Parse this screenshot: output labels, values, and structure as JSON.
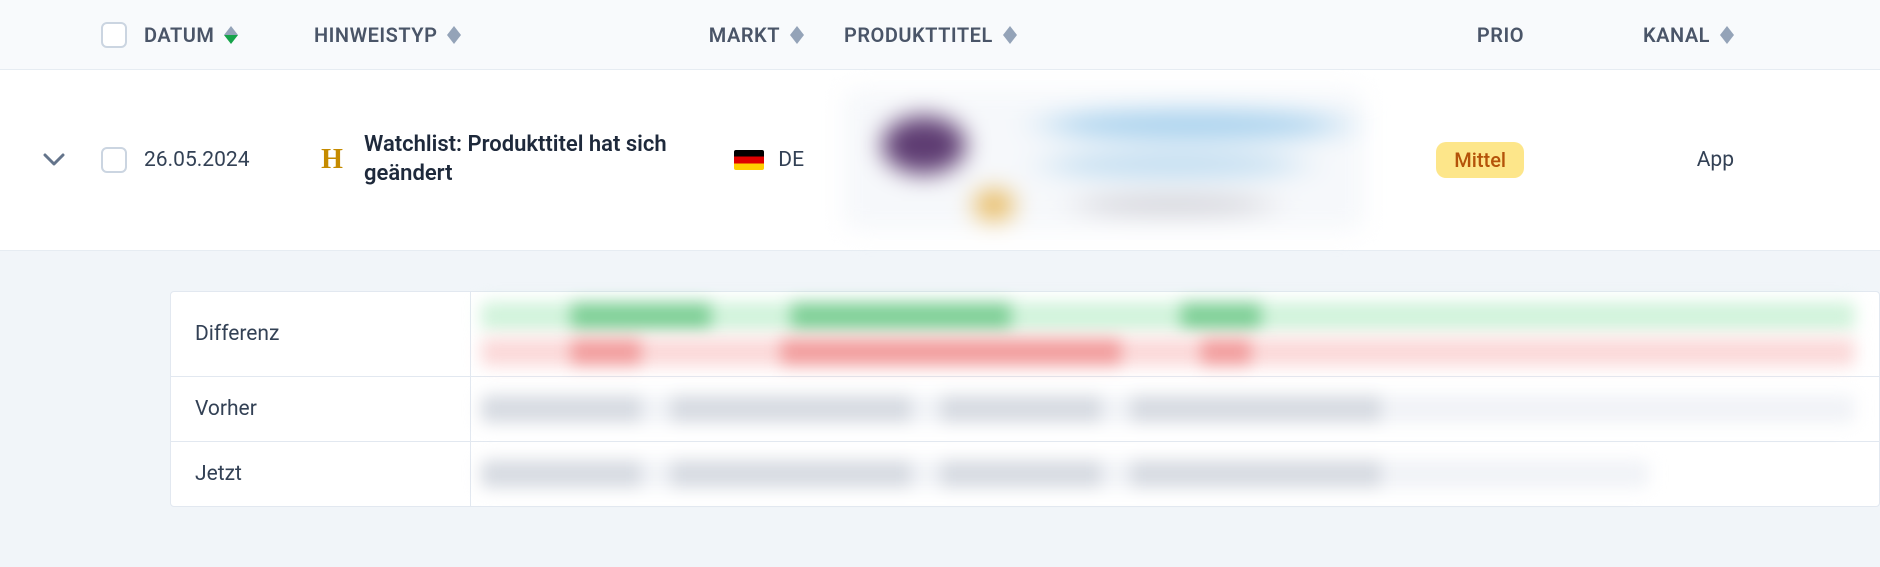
{
  "columns": {
    "datum": "Datum",
    "hinweistyp": "Hinweistyp",
    "markt": "Markt",
    "produkttitel": "Produkttitel",
    "prio": "Prio",
    "kanal": "Kanal"
  },
  "row": {
    "date": "26.05.2024",
    "type_icon_letter": "H",
    "type_text": "Watchlist: Produkttitel hat sich geändert",
    "market_code": "DE",
    "prio_label": "Mittel",
    "channel": "App"
  },
  "detail": {
    "labels": {
      "diff": "Differenz",
      "before": "Vorher",
      "now": "Jetzt"
    }
  },
  "colors": {
    "prio_mittel_bg": "#fde68a",
    "prio_mittel_fg": "#b45309",
    "sort_active_down": "#16a34a"
  }
}
